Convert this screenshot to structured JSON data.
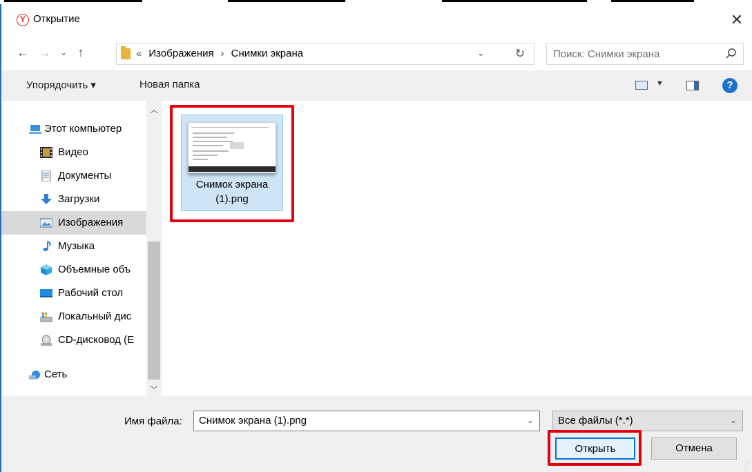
{
  "window": {
    "title": "Открытие",
    "app_icon_letter": "Y"
  },
  "navigation": {
    "breadcrumbs": [
      "Изображения",
      "Снимки экрана"
    ],
    "search_placeholder": "Поиск: Снимки экрана"
  },
  "toolbar": {
    "organize_label": "Упорядочить ▾",
    "new_folder_label": "Новая папка"
  },
  "sidebar": {
    "items": [
      {
        "label": "Этот компьютер",
        "icon": "computer-icon"
      },
      {
        "label": "Видео",
        "icon": "video-icon"
      },
      {
        "label": "Документы",
        "icon": "documents-icon"
      },
      {
        "label": "Загрузки",
        "icon": "downloads-icon"
      },
      {
        "label": "Изображения",
        "icon": "pictures-icon",
        "selected": true
      },
      {
        "label": "Музыка",
        "icon": "music-icon"
      },
      {
        "label": "Объемные объ",
        "icon": "3d-objects-icon"
      },
      {
        "label": "Рабочий стол",
        "icon": "desktop-icon"
      },
      {
        "label": "Локальный дис",
        "icon": "local-disk-icon"
      },
      {
        "label": "CD-дисковод (E",
        "icon": "cd-drive-icon"
      },
      {
        "label": "Сеть",
        "icon": "network-icon"
      }
    ]
  },
  "files": [
    {
      "name_line1": "Снимок экрана",
      "name_line2": "(1).png",
      "selected": true
    }
  ],
  "bottom": {
    "filename_label": "Имя файла:",
    "filename_value": "Снимок экрана (1).png",
    "filetype_value": "Все файлы (*.*)",
    "open_label": "Открыть",
    "cancel_label": "Отмена"
  },
  "colors": {
    "highlight": "#e0000f",
    "selection": "#cde5f7",
    "accent": "#0078d7"
  }
}
